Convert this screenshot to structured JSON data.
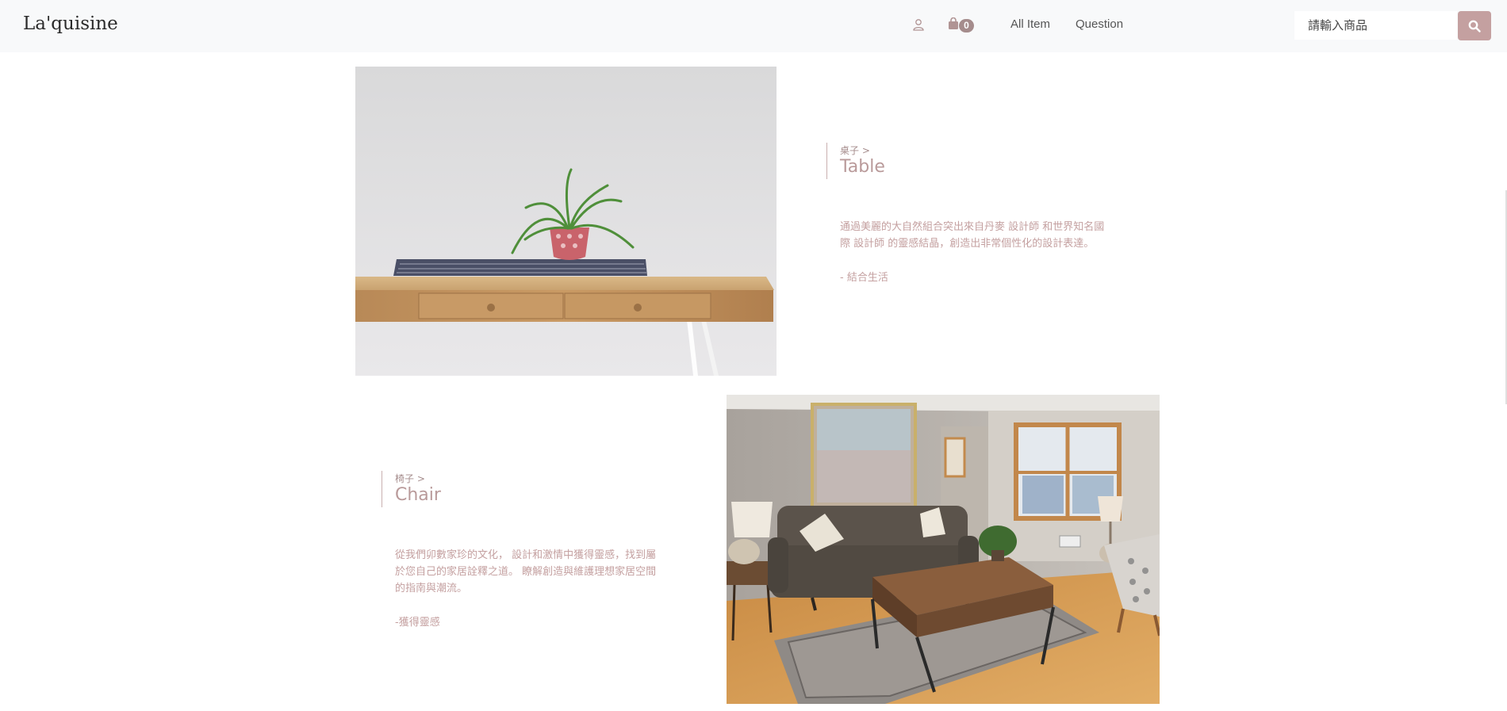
{
  "navbar": {
    "brand": "La'quisine",
    "cart_count": "0",
    "links": [
      "All Item",
      "Question"
    ],
    "search": {
      "placeholder": "請輸入商品",
      "value": ""
    },
    "icons": {
      "user": "user-icon",
      "cart": "shopping-bag-icon",
      "search": "search-icon"
    },
    "colors": {
      "accent": "#c4a0a0",
      "badge": "#a58c8c",
      "bar_bg": "#f8f9fa"
    }
  },
  "products": [
    {
      "breadcrumb": "桌子 >",
      "title": "Table",
      "description": "通過美麗的大自然組合突出來自丹麥 設計師 和世界知名國際 設計師 的靈感結晶，創造出非常個性化的設計表達。",
      "tagline": "- 結合生活"
    },
    {
      "breadcrumb": "椅子 >",
      "title": "Chair",
      "description": "從我們卯數家珍的文化， 設計和激情中獲得靈感，找到屬於您自己的家居詮釋之道。 瞭解創造與維護理想家居空間的指南與潮流。",
      "tagline": "-獲得靈感"
    }
  ]
}
